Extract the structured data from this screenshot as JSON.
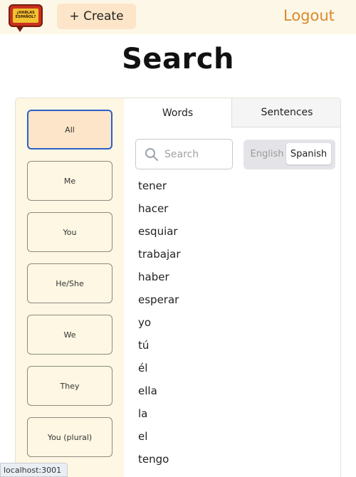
{
  "header": {
    "logo_text": "¿HABLAS ESPAÑOL?",
    "create_label": "+ Create",
    "logout_label": "Logout"
  },
  "page": {
    "title": "Search"
  },
  "sidebar": {
    "items": [
      {
        "label": "All",
        "active": true
      },
      {
        "label": "Me"
      },
      {
        "label": "You"
      },
      {
        "label": "He/She"
      },
      {
        "label": "We"
      },
      {
        "label": "They"
      },
      {
        "label": "You (plural)"
      }
    ]
  },
  "tabs": {
    "words": "Words",
    "sentences": "Sentences"
  },
  "search": {
    "placeholder": "Search",
    "value": ""
  },
  "language": {
    "english": "English",
    "spanish": "Spanish",
    "selected": "Spanish"
  },
  "words": [
    "tener",
    "hacer",
    "esquiar",
    "trabajar",
    "haber",
    "esperar",
    "yo",
    "tú",
    "él",
    "ella",
    "la",
    "el",
    "tengo"
  ],
  "status": {
    "url": "localhost:3001"
  },
  "colors": {
    "accent": "#d98a2c",
    "create_bg": "#fce5c8",
    "sidebar_bg": "#fdf7e3",
    "active_border": "#2f5fc9"
  },
  "icons": {
    "search": "search-icon",
    "logo": "logo-icon"
  }
}
